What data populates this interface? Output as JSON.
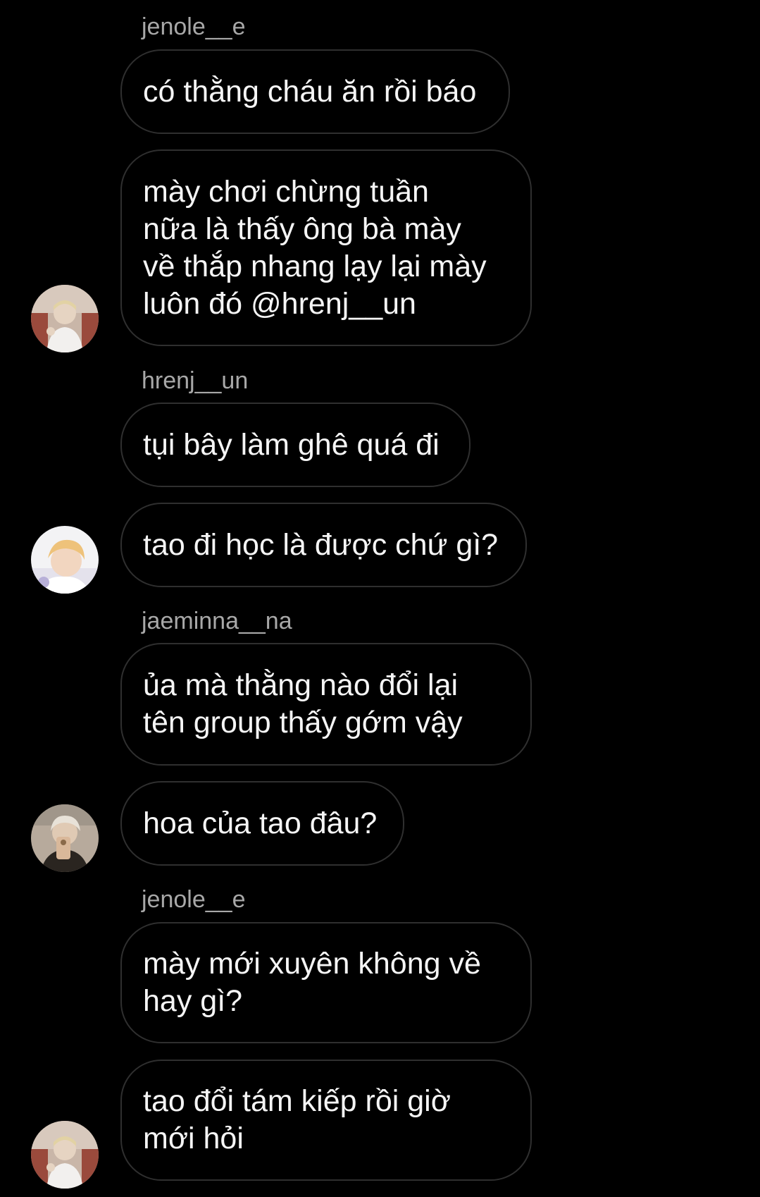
{
  "messages": [
    {
      "sender": "jenole__e",
      "text": "có thằng cháu ăn rồi báo"
    },
    {
      "text": "mày chơi chừng tuần\nnữa là thấy ông bà mày\nvề thắp nhang lạy lại mày\nluôn đó @hrenj__un"
    },
    {
      "sender": "hrenj__un",
      "text": "tụi bây làm ghê quá đi"
    },
    {
      "text": "tao đi học là được chứ gì?"
    },
    {
      "sender": "jaeminna__na",
      "text": "ủa mà thằng nào đổi lại\ntên group thấy gớm vậy"
    },
    {
      "text": "hoa của tao đâu?"
    },
    {
      "sender": "jenole__e",
      "text": "mày mới xuyên không về\nhay gì?"
    },
    {
      "text": "tao đổi tám kiếp rồi giờ\nmới hỏi"
    }
  ],
  "avatars": [
    {
      "user": "jenole__e",
      "icon": "profile-photo-icon"
    },
    {
      "user": "hrenj__un",
      "icon": "profile-photo-icon"
    },
    {
      "user": "jaeminna__na",
      "icon": "profile-photo-icon"
    },
    {
      "user": "jenole__e",
      "icon": "profile-photo-icon"
    }
  ],
  "colors": {
    "background": "#000000",
    "bubble_border": "#2f2f2f",
    "sender_text": "#a8a8a8",
    "message_text": "#f5f5f5"
  }
}
